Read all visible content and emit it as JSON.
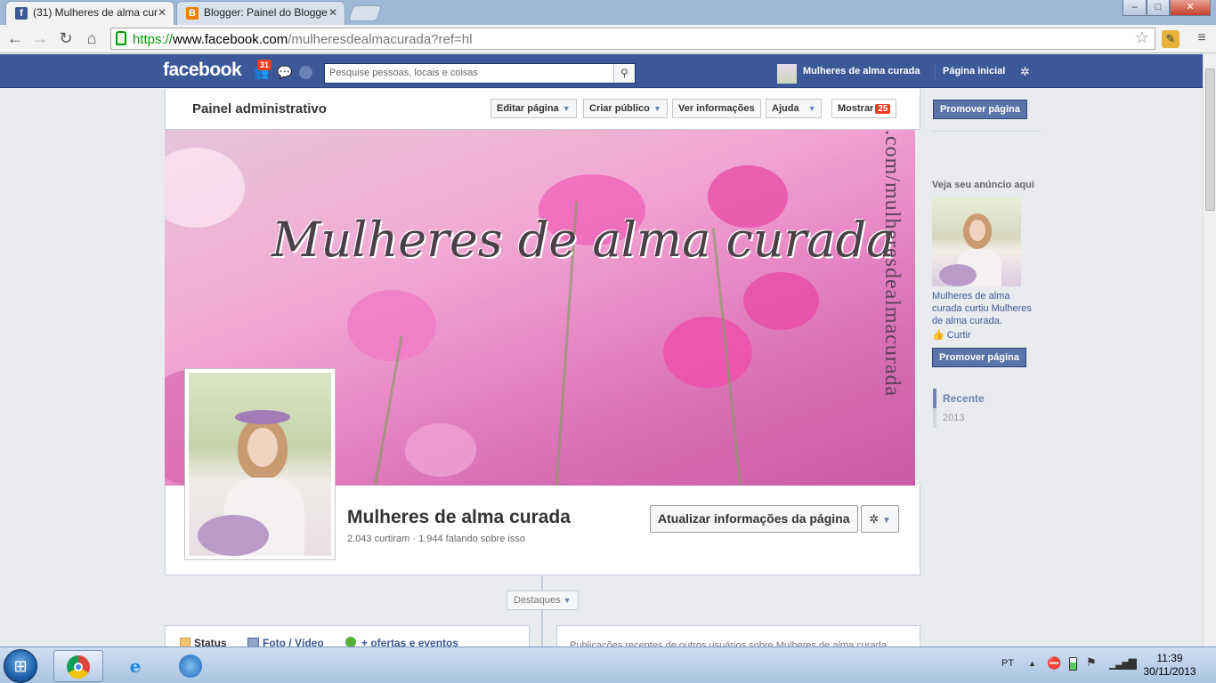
{
  "browser": {
    "tabs": [
      {
        "title": "(31) Mulheres de alma cur",
        "icon": "facebook-icon",
        "active": true
      },
      {
        "title": "Blogger: Painel do Blogge",
        "icon": "blogger-icon",
        "active": false
      }
    ],
    "url": {
      "scheme": "https://",
      "host": "www.facebook.com",
      "path": "/mulheresdealmacurada?ref=hl"
    },
    "window_controls": {
      "minimize": "–",
      "maximize": "□",
      "close": "✕"
    }
  },
  "fb_header": {
    "logo": "facebook",
    "notification_count": "31",
    "search_placeholder": "Pesquise pessoas, locais e coisas",
    "profile_link": "Mulheres de alma curada",
    "home_link": "Página inicial"
  },
  "admin_panel": {
    "title": "Painel administrativo",
    "buttons": {
      "edit_page": "Editar página",
      "create_audience": "Criar público",
      "view_info": "Ver informações",
      "help": "Ajuda",
      "show": "Mostrar",
      "show_count": "25"
    }
  },
  "cover": {
    "title": "Mulheres de alma curada",
    "vertical_url": ".com/mulheresdealmacurada"
  },
  "page": {
    "name": "Mulheres de alma curada",
    "stats": "2.043 curtiram · 1.944 falando sobre isso",
    "update_button": "Atualizar informações da página",
    "highlights": "Destaques"
  },
  "composer": {
    "status": "Status",
    "photo_video": "Foto / Vídeo",
    "offers_events": "+ ofertas e eventos"
  },
  "recent_posts": "Publicações recentes de outros usuários sobre Mulheres de alma curada",
  "sidebar": {
    "promote_top": "Promover página",
    "ad_title": "Veja seu anúncio aqui",
    "ad_text": "Mulheres de alma curada curtiu Mulheres de alma curada.",
    "ad_like": "Curtir",
    "promote_bottom": "Promover página",
    "timeline_nav": {
      "recent": "Recente",
      "year": "2013"
    }
  },
  "taskbar": {
    "language": "PT",
    "time": "11:39",
    "date": "30/11/2013"
  },
  "colors": {
    "fb_blue": "#3b5998",
    "notification_red": "#f03d25",
    "promote_button": "#5b74a8"
  }
}
